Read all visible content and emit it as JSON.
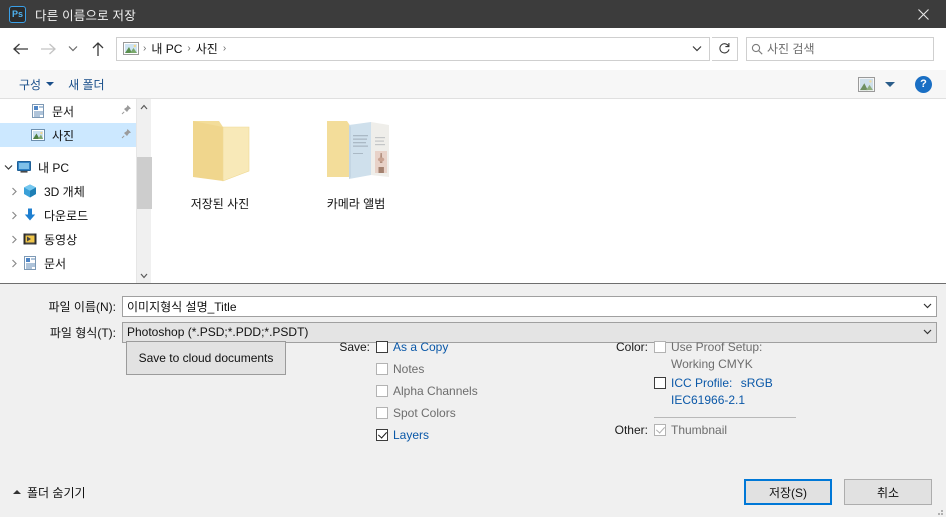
{
  "window": {
    "app_icon": "photoshop-ps-icon",
    "title": "다른 이름으로 저장",
    "close_label": "✕",
    "titlebar_color": "#3c3c3c"
  },
  "nav": {
    "back_icon": "arrow-left-icon",
    "forward_icon": "arrow-right-icon",
    "recent_icon": "chevron-down-icon",
    "up_icon": "arrow-up-icon",
    "address": {
      "icon": "pictures-folder-icon",
      "crumbs": [
        "내 PC",
        "사진"
      ],
      "separator": "›",
      "dropdown_icon": "chevron-down-icon"
    },
    "refresh_icon": "refresh-icon",
    "search": {
      "icon": "search-icon",
      "placeholder": "사진 검색",
      "value": ""
    }
  },
  "toolbar": {
    "organize_label": "구성",
    "new_folder_label": "새 폴더",
    "view_icon": "view-mode-icon",
    "view_caret_icon": "caret-down-icon",
    "help_label": "?",
    "help_icon": "help-circle-icon"
  },
  "sidebar": {
    "items": [
      {
        "label": "문서",
        "icon": "documents-icon",
        "indent": 2,
        "expander": "",
        "pinned": true,
        "selected": false
      },
      {
        "label": "사진",
        "icon": "pictures-icon",
        "indent": 2,
        "expander": "",
        "pinned": true,
        "selected": true
      },
      {
        "label": "내 PC",
        "icon": "this-pc-icon",
        "indent": 0,
        "expander": "open",
        "pinned": false,
        "selected": false
      },
      {
        "label": "3D 개체",
        "icon": "3d-objects-icon",
        "indent": 1,
        "expander": "closed",
        "pinned": false,
        "selected": false
      },
      {
        "label": "다운로드",
        "icon": "downloads-icon",
        "indent": 1,
        "expander": "closed",
        "pinned": false,
        "selected": false
      },
      {
        "label": "동영상",
        "icon": "videos-icon",
        "indent": 1,
        "expander": "closed",
        "pinned": false,
        "selected": false
      },
      {
        "label": "문서",
        "icon": "documents-icon",
        "indent": 1,
        "expander": "closed",
        "pinned": false,
        "selected": false
      }
    ],
    "scrollbar": {
      "up_icon": "scroll-up-icon",
      "down_icon": "scroll-down-icon",
      "thumb_top_pct": 28,
      "thumb_height_pct": 34
    }
  },
  "files": [
    {
      "name": "저장된 사진",
      "icon": "folder-empty-icon"
    },
    {
      "name": "카메라 앨범",
      "icon": "folder-with-photos-icon"
    }
  ],
  "form": {
    "filename_label": "파일 이름(N):",
    "filename_value": "이미지형식 설명_Title",
    "filetype_label": "파일 형식(T):",
    "filetype_value": "Photoshop (*.PSD;*.PDD;*.PSDT)",
    "dropdown_icon": "chevron-down-icon"
  },
  "options": {
    "cloud_button": "Save to cloud documents",
    "save_group_label": "Save:",
    "save_items": [
      {
        "label": "As a Copy",
        "checked": false,
        "enabled": true
      },
      {
        "label": "Notes",
        "checked": false,
        "enabled": false
      },
      {
        "label": "Alpha Channels",
        "checked": false,
        "enabled": false
      },
      {
        "label": "Spot Colors",
        "checked": false,
        "enabled": false
      },
      {
        "label": "Layers",
        "checked": true,
        "enabled": true
      }
    ],
    "color_group_label": "Color:",
    "proof_setup": {
      "label": "Use Proof Setup:",
      "sub": "Working CMYK",
      "checked": false,
      "enabled": false
    },
    "icc_profile": {
      "label": "ICC Profile:",
      "value": "sRGB",
      "sub": "IEC61966-2.1",
      "checked": false,
      "enabled": true
    },
    "other_group_label": "Other:",
    "thumbnail": {
      "label": "Thumbnail",
      "checked": true,
      "enabled": false
    }
  },
  "footer": {
    "hide_folders_label": "폴더 숨기기",
    "hide_folders_icon": "caret-up-icon",
    "save_button": "저장(S)",
    "cancel_button": "취소",
    "accent_color": "#0078d7"
  }
}
